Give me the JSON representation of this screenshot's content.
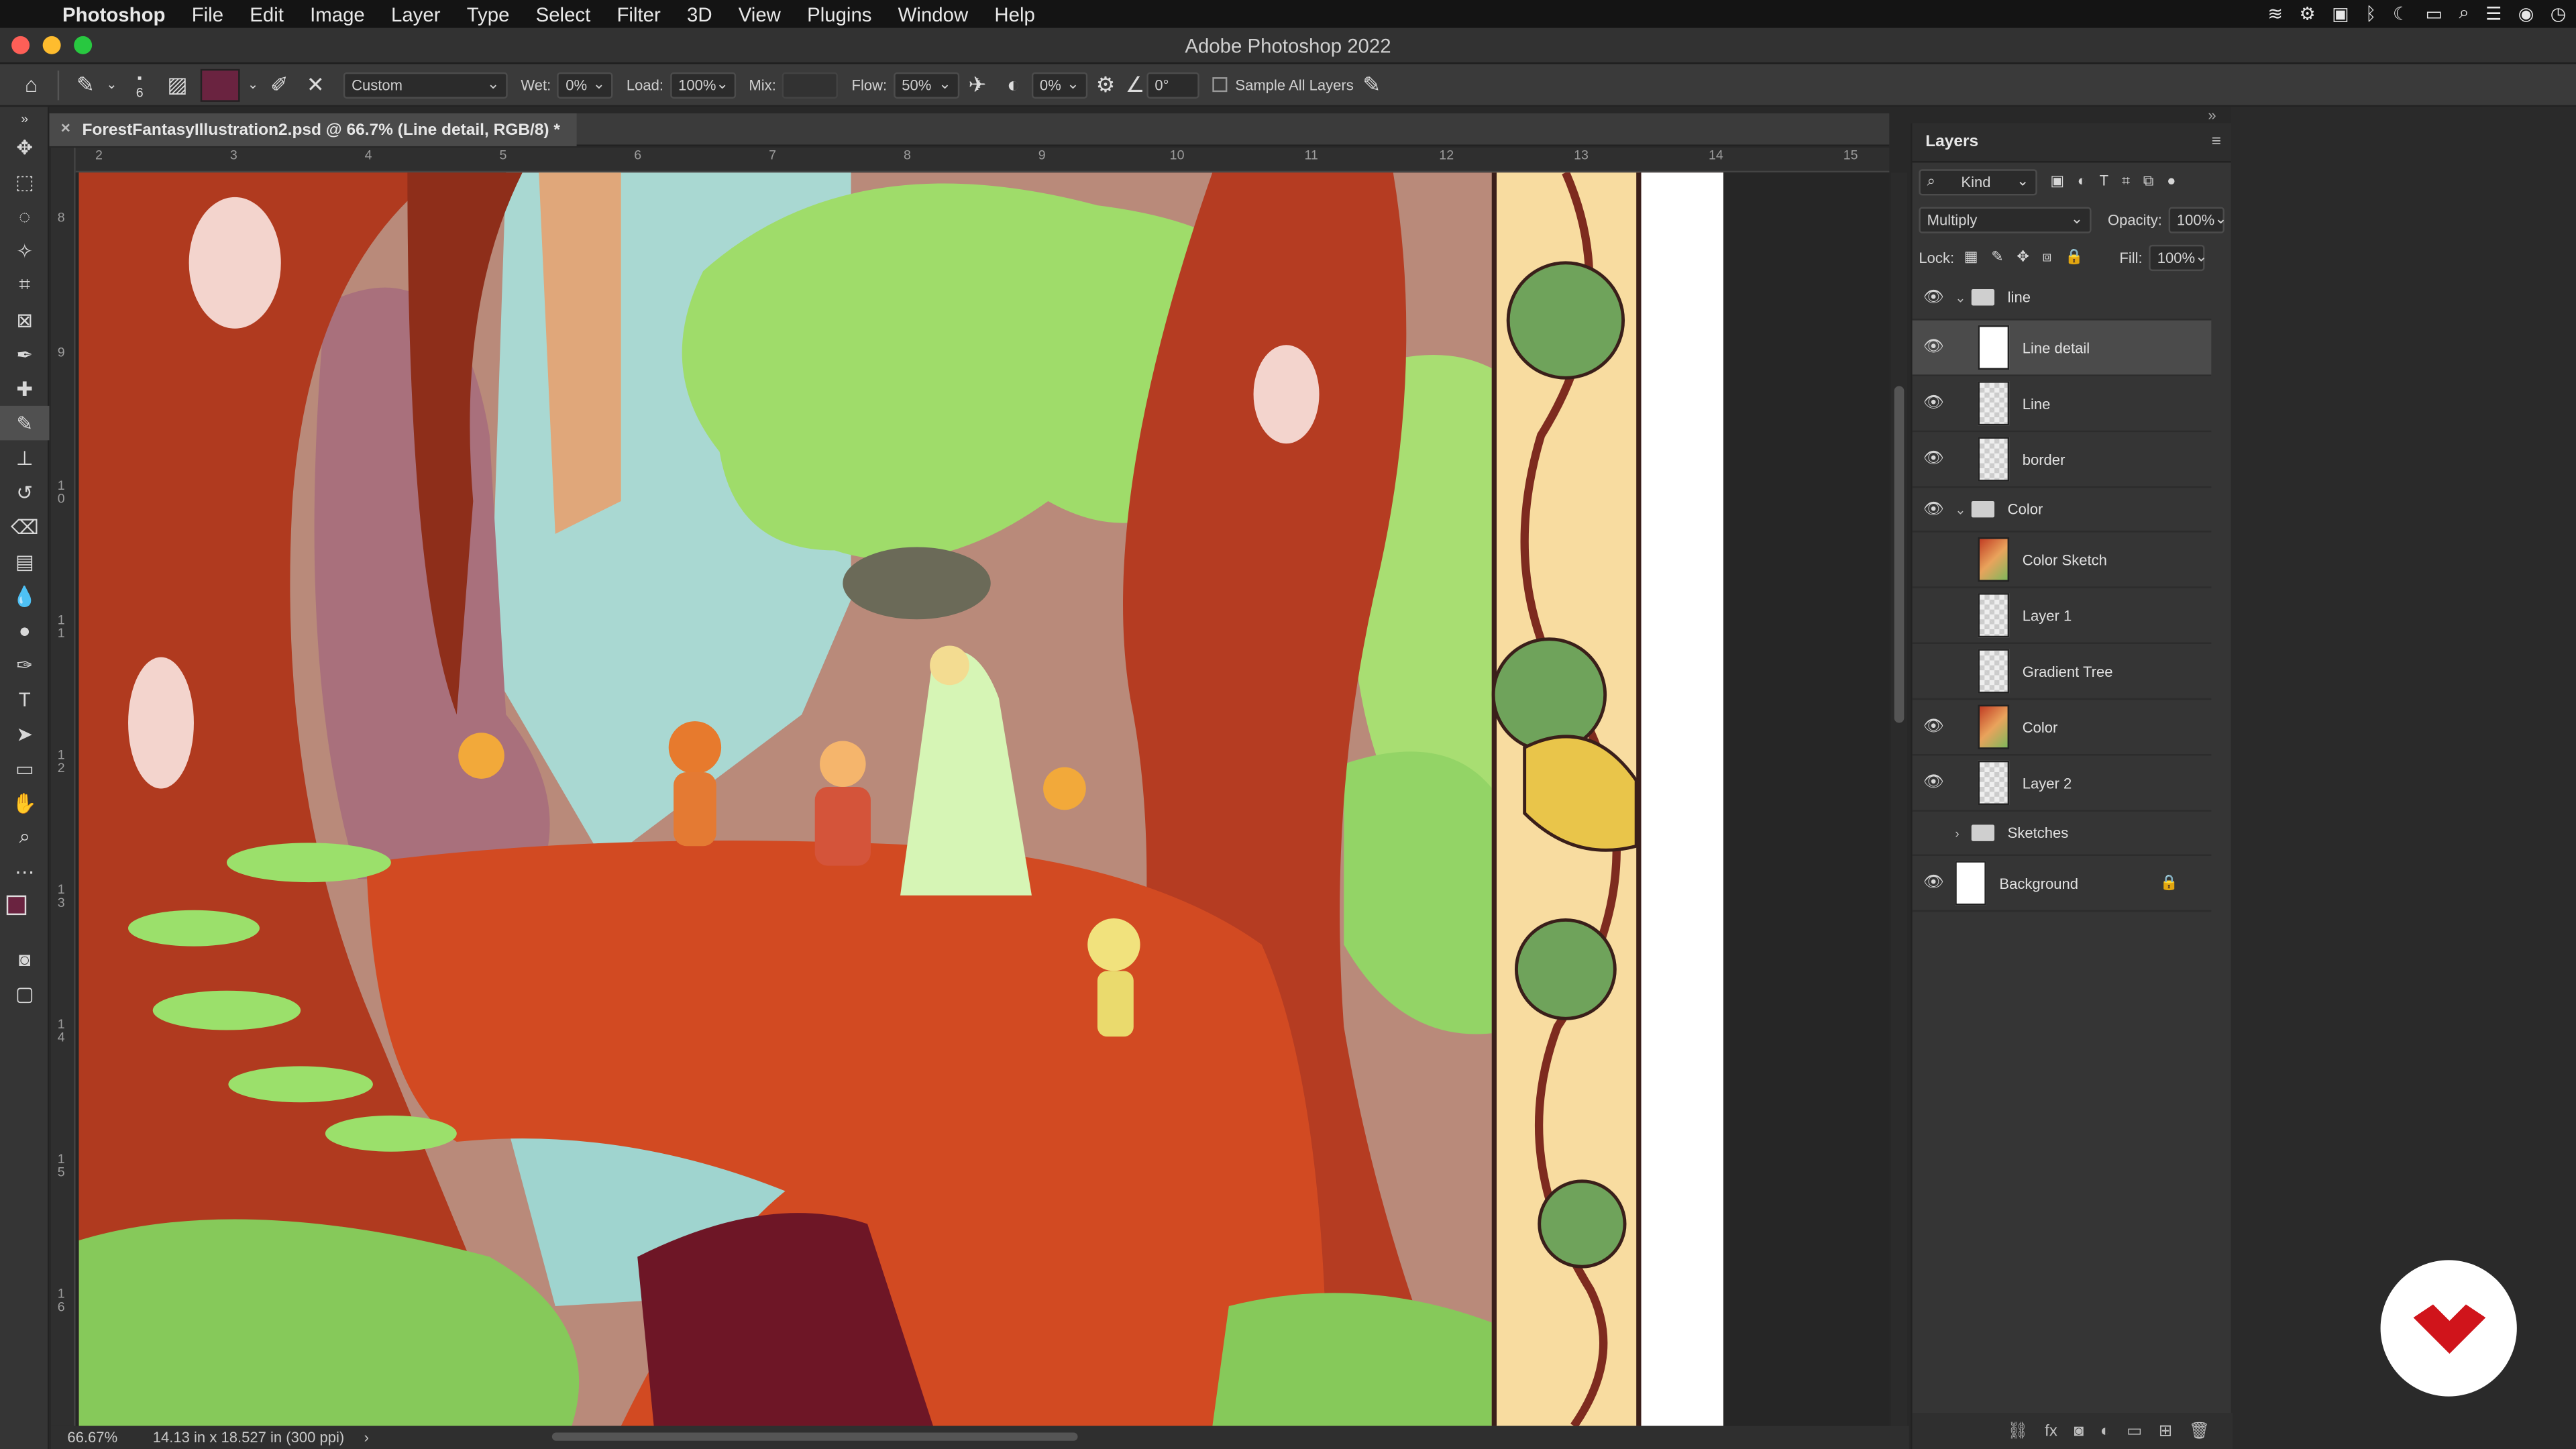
{
  "menubar": {
    "app": "Photoshop",
    "items": [
      "File",
      "Edit",
      "Image",
      "Layer",
      "Type",
      "Select",
      "Filter",
      "3D",
      "View",
      "Plugins",
      "Window",
      "Help"
    ]
  },
  "window": {
    "title": "Adobe Photoshop 2022"
  },
  "options": {
    "brush_size": "6",
    "preset": "Custom",
    "wet_label": "Wet:",
    "wet_value": "0%",
    "load_label": "Load:",
    "load_value": "100%",
    "mix_label": "Mix:",
    "flow_label": "Flow:",
    "flow_value": "50%",
    "smoothing_value": "0%",
    "angle_value": "0°",
    "sample_all_label": "Sample All Layers",
    "brush_color": "#6a2340"
  },
  "document": {
    "tab_title": "ForestFantasyIllustration2.psd @ 66.7% (Line detail, RGB/8) *",
    "zoom": "66.67%",
    "doc_size": "14.13 in x 18.527 in (300 ppi)",
    "ruler_h": [
      "2",
      "3",
      "4",
      "5",
      "6",
      "7",
      "8",
      "9",
      "10",
      "11",
      "12",
      "13",
      "14",
      "15"
    ],
    "ruler_v": [
      "8",
      "9",
      "1 0",
      "1 1",
      "1 2",
      "1 3",
      "1 4",
      "1 5",
      "1 6"
    ]
  },
  "layers_panel": {
    "title": "Layers",
    "filter_kind": "Kind",
    "blend_mode": "Multiply",
    "opacity_label": "Opacity:",
    "opacity": "100%",
    "lock_label": "Lock:",
    "fill_label": "Fill:",
    "fill": "100%",
    "layers": [
      {
        "name": "line",
        "type": "group",
        "visible": true,
        "expanded": true
      },
      {
        "name": "Line detail",
        "type": "layer",
        "visible": true,
        "selected": true
      },
      {
        "name": "Line",
        "type": "layer",
        "visible": true
      },
      {
        "name": "border",
        "type": "layer",
        "visible": true
      },
      {
        "name": "Color",
        "type": "group",
        "visible": true,
        "expanded": true
      },
      {
        "name": "Color Sketch",
        "type": "layer",
        "visible": false
      },
      {
        "name": "Layer 1",
        "type": "layer",
        "visible": false
      },
      {
        "name": "Gradient Tree",
        "type": "layer",
        "visible": false
      },
      {
        "name": "Color",
        "type": "layer",
        "visible": true
      },
      {
        "name": "Layer 2",
        "type": "layer",
        "visible": true
      },
      {
        "name": "Sketches",
        "type": "group",
        "visible": false,
        "expanded": false
      },
      {
        "name": "Background",
        "type": "layer",
        "visible": true,
        "locked": true
      }
    ]
  }
}
